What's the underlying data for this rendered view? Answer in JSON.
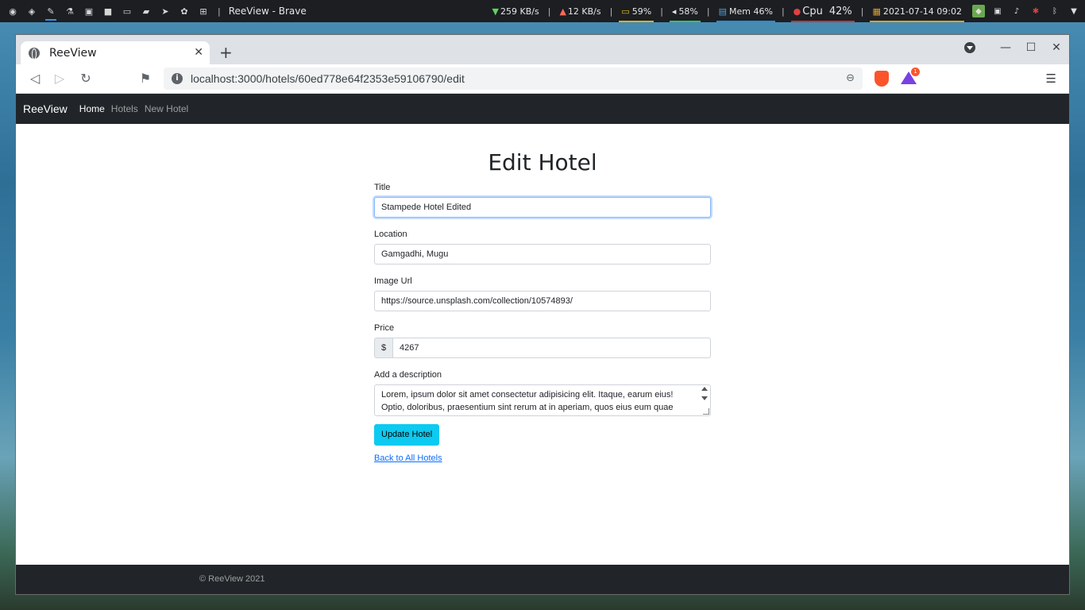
{
  "taskbar": {
    "window_title": "ReeView - Brave",
    "separator": "|",
    "net_down": "259 KB/s",
    "net_up": "12 KB/s",
    "battery": "59%",
    "volume": "58%",
    "mem": "Mem 46%",
    "cpu_label": "Cpu",
    "cpu_value": "42%",
    "datetime": "2021-07-14 09:02"
  },
  "browser": {
    "tab_title": "ReeView",
    "url": "localhost:3000/hotels/60ed778e64f2353e59106790/edit",
    "rewards_count": "1"
  },
  "site": {
    "brand": "ReeView",
    "nav": [
      "Home",
      "Hotels",
      "New Hotel"
    ],
    "footer": "© ReeView 2021"
  },
  "form": {
    "heading": "Edit Hotel",
    "title_label": "Title",
    "title_value": "Stampede Hotel Edited",
    "location_label": "Location",
    "location_value": "Gamgadhi, Mugu",
    "image_label": "Image Url",
    "image_value": "https://source.unsplash.com/collection/10574893/",
    "price_label": "Price",
    "price_addon": "$",
    "price_value": "4267",
    "description_label": "Add a description",
    "description_value": "Lorem, ipsum dolor sit amet consectetur adipisicing elit. Itaque, earum eius! Optio, doloribus, praesentium sint rerum at in aperiam, quos eius eum quae",
    "submit_label": "Update Hotel",
    "back_link": "Back to All Hotels"
  },
  "colors": {
    "navbar": "#212529",
    "accent_button": "#0dcaf0",
    "link": "#0d6efd"
  }
}
